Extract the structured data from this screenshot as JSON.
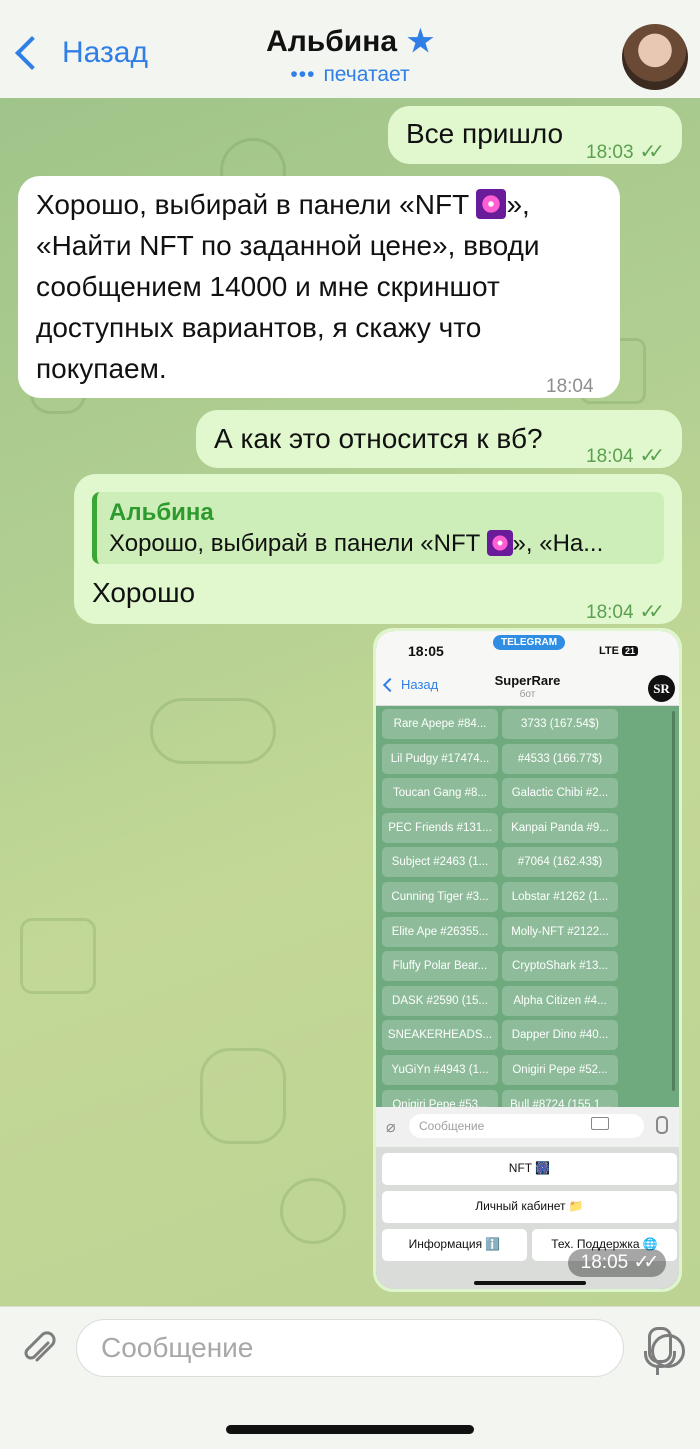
{
  "header": {
    "back_label": "Назад",
    "contact_name": "Альбина",
    "status": "печатает",
    "status_dots": "•••"
  },
  "messages": [
    {
      "type": "outgoing",
      "text": "Все пришло",
      "time": "18:03"
    },
    {
      "type": "incoming",
      "lines": [
        "Хорошо, выбирай в панели «NFT ",
        "», «Найти NFT по заданной цене», вводи сообщением 14000 и мне скриншот доступных вариантов, я скажу что покупаем."
      ],
      "time": "18:04"
    },
    {
      "type": "outgoing",
      "text": "А как это относится к вб?",
      "time": "18:04"
    },
    {
      "type": "outgoing_reply",
      "reply_name": "Альбина",
      "reply_text_a": "Хорошо, выбирай в панели «NFT ",
      "reply_text_b": "», «На...",
      "text": "Хорошо",
      "time": "18:04"
    },
    {
      "type": "outgoing_photo",
      "time": "18:05"
    }
  ],
  "screenshot": {
    "status_time": "18:05",
    "telegram_badge": "TELEGRAM",
    "network": "LTE",
    "battery": "21",
    "back_label": "Назад",
    "bot_name": "SuperRare",
    "bot_sub": "бот",
    "logo": "SR",
    "buttons": [
      [
        "Rare Apepe #84...",
        "3733 (167.54$)"
      ],
      [
        "Lil Pudgy #17474...",
        "#4533 (166.77$)"
      ],
      [
        "Toucan Gang #8...",
        "Galactic Chibi #2..."
      ],
      [
        "PEC Friends #131...",
        "Kanpai Panda #9..."
      ],
      [
        "Subject #2463 (1...",
        "#7064 (162.43$)"
      ],
      [
        "Cunning Tiger #3...",
        "Lobstar #1262 (1..."
      ],
      [
        "Elite Ape #26355...",
        "Molly-NFT #2122..."
      ],
      [
        "Fluffy Polar Bear...",
        "CryptoShark #13..."
      ],
      [
        "DASK #2590 (15...",
        "Alpha Citizen #4..."
      ],
      [
        "SNEAKERHEADS...",
        "Dapper Dino #40..."
      ],
      [
        "YuGiYn #4943 (1...",
        "Onigiri Pepe #52..."
      ],
      [
        "Onigiri Pepe #53...",
        "Bull #8724 (155.1..."
      ]
    ],
    "input_placeholder": "Сообщение",
    "kb_nft": "NFT 🎆",
    "kb_cabinet": "Личный кабинет 📁",
    "kb_info": "Информация ℹ️",
    "kb_support": "Тех. Поддержка 🌐"
  },
  "composer": {
    "placeholder": "Сообщение"
  },
  "colors": {
    "accent": "#2f7fe6",
    "outgoing_bubble": "#e1f8cf",
    "time_green": "#5aa04f"
  }
}
